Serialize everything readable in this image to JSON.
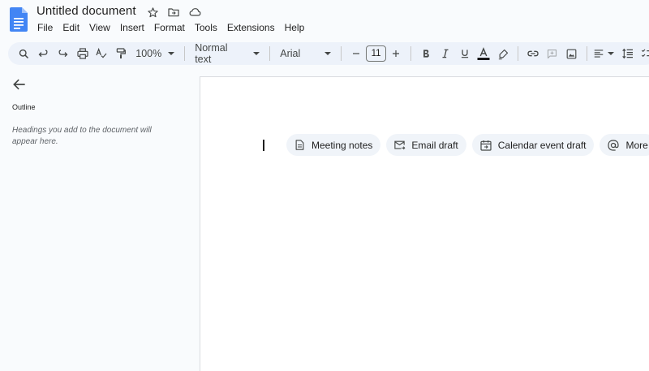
{
  "header": {
    "title": "Untitled document",
    "menu": [
      "File",
      "Edit",
      "View",
      "Insert",
      "Format",
      "Tools",
      "Extensions",
      "Help"
    ]
  },
  "toolbar": {
    "zoom": "100%",
    "style": "Normal text",
    "font": "Arial",
    "font_size": "11"
  },
  "sidebar": {
    "outline_label": "Outline",
    "outline_hint": "Headings you add to the document will appear here."
  },
  "chips": [
    {
      "label": "Meeting notes",
      "icon": "document-icon"
    },
    {
      "label": "Email draft",
      "icon": "email-icon"
    },
    {
      "label": "Calendar event draft",
      "icon": "calendar-icon"
    },
    {
      "label": "More",
      "icon": "at-icon"
    }
  ],
  "colors": {
    "docs_blue": "#4285f4",
    "toolbar_bg": "#edf2fa",
    "chip_bg": "#f0f4f9"
  }
}
